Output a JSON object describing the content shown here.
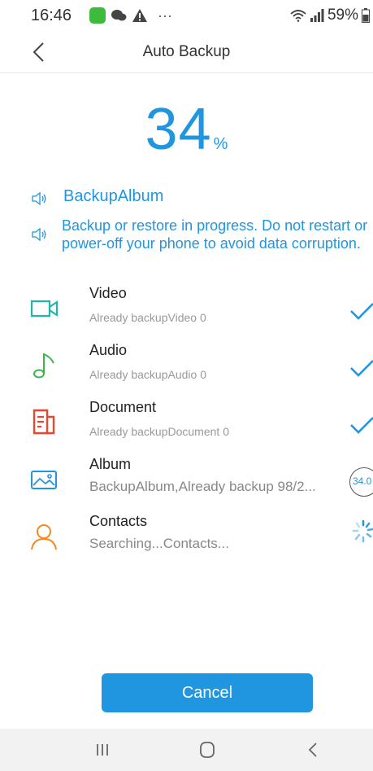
{
  "status_bar": {
    "time": "16:46",
    "dots": "···",
    "battery": "59%"
  },
  "header": {
    "title": "Auto Backup"
  },
  "progress": {
    "value": "34",
    "unit": "%"
  },
  "notices": [
    {
      "text": "BackupAlbum"
    },
    {
      "text": "Backup or restore in progress. Do not restart or power-off your phone to avoid data corruption."
    }
  ],
  "items": [
    {
      "title": "Video",
      "subtitle": "Already backupVideo  0",
      "icon": "video-icon",
      "status": "done"
    },
    {
      "title": "Audio",
      "subtitle": "Already backupAudio  0",
      "icon": "audio-icon",
      "status": "done"
    },
    {
      "title": "Document",
      "subtitle": "Already backupDocument  0",
      "icon": "document-icon",
      "status": "done"
    },
    {
      "title": "Album",
      "subtitle": "BackupAlbum,Already backup 98/2...",
      "icon": "album-icon",
      "status": "progress",
      "status_label": "34.0"
    },
    {
      "title": "Contacts",
      "subtitle": "Searching...Contacts...",
      "icon": "contacts-icon",
      "status": "loading"
    }
  ],
  "cancel_label": "Cancel",
  "colors": {
    "accent": "#2196e0",
    "video": "#1fb5a8",
    "audio": "#3cb54a",
    "document": "#e8482f",
    "album": "#2196e0",
    "contacts": "#f08a24"
  }
}
